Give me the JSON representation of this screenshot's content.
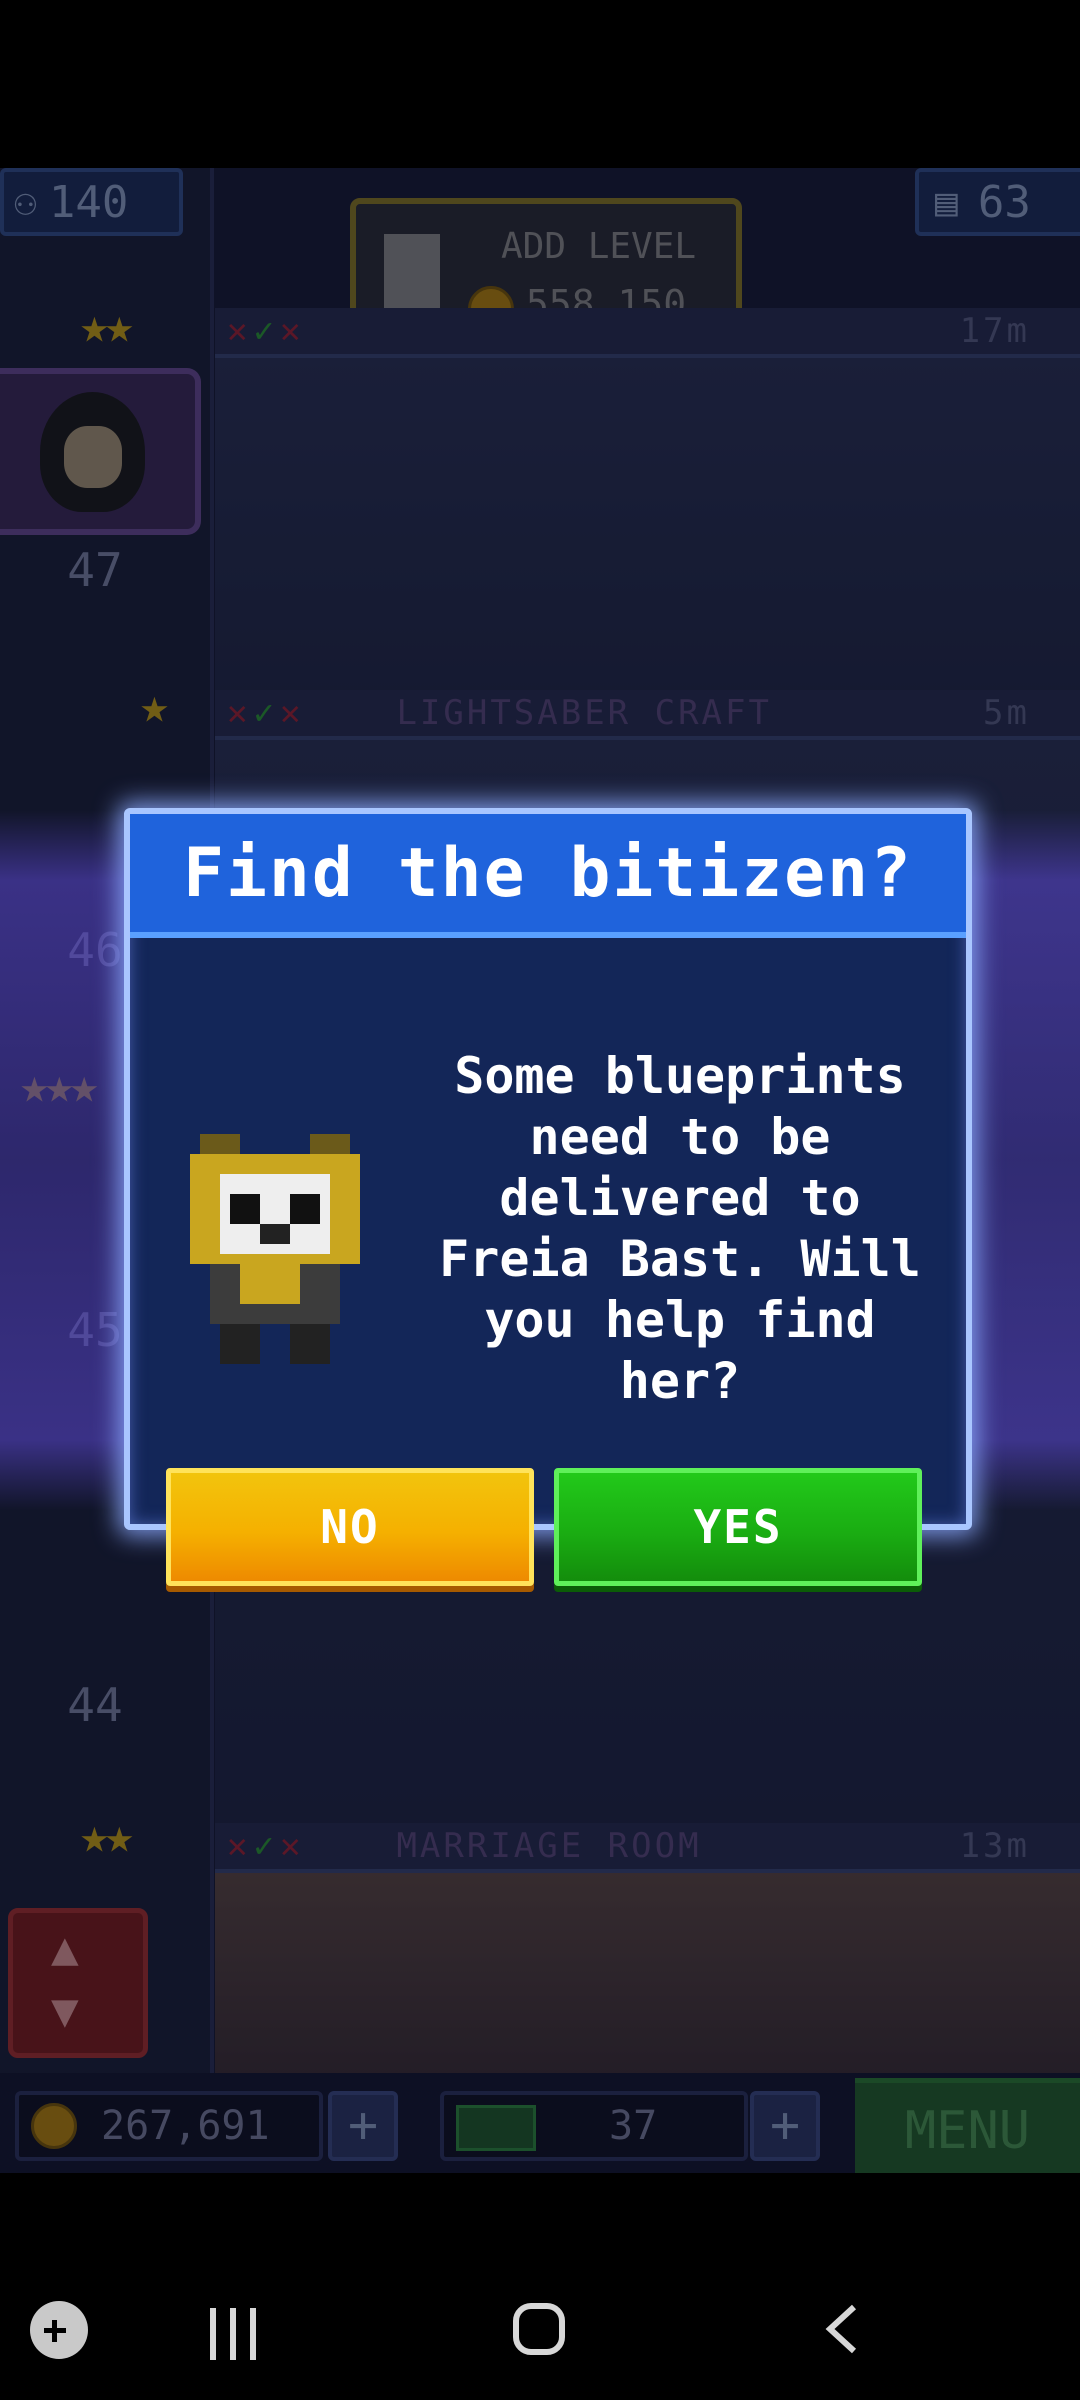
{
  "hud": {
    "population": "140",
    "floors": "63",
    "add_level_label": "ADD LEVEL",
    "add_level_cost": "558,150"
  },
  "tower": {
    "levels": [
      {
        "num": "47",
        "name": "",
        "dist": "17m"
      },
      {
        "num": "46",
        "name": "LIGHTSABER CRAFT",
        "dist": "5m"
      },
      {
        "num": "45",
        "name": "",
        "dist": ""
      },
      {
        "num": "44",
        "name": "",
        "dist": ""
      },
      {
        "num": "",
        "name": "MARRIAGE ROOM",
        "dist": "13m"
      }
    ]
  },
  "bottom": {
    "coins": "267,691",
    "bux": "37",
    "menu_label": "MENU"
  },
  "dialog": {
    "title": "Find the bitizen?",
    "message": "Some blueprints need to be delivered to Freia Bast. Will you help find her?",
    "no_label": "NO",
    "yes_label": "YES"
  },
  "colors": {
    "dialog_title_bg": "#1f63dc",
    "no_button": "#f5b000",
    "yes_button": "#1aad12"
  },
  "icons": [
    "person-icon",
    "floors-icon",
    "coin-icon",
    "bux-icon",
    "panda-bitizen-icon",
    "game-launcher-icon",
    "recent-apps-icon",
    "home-icon",
    "back-icon"
  ]
}
